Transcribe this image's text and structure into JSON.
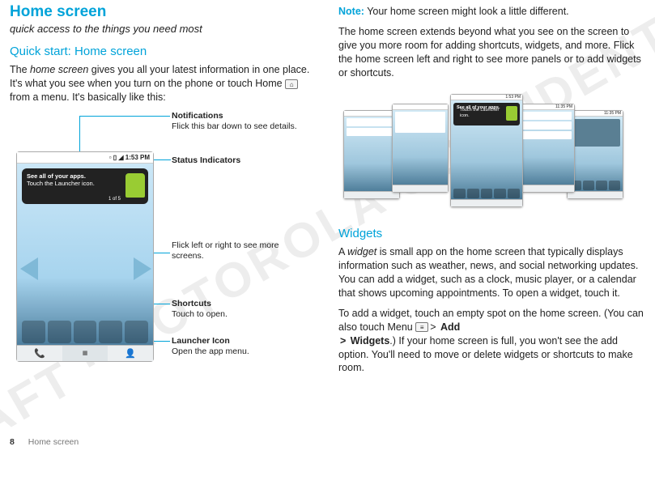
{
  "title": "Home screen",
  "subtitle": "quick access to the things you need most",
  "section_quick": "Quick start: Home screen",
  "intro_1": "The ",
  "intro_home_screen": "home screen",
  "intro_2": " gives you all your latest information in one place. It's what you see when you turn on the phone or touch Home ",
  "intro_3": " from a menu. It's basically like this:",
  "statusbar_time": "1:53 PM",
  "signal_icons": "▫ ▯ ◢",
  "tip_line1": "See all of your apps.",
  "tip_line2": "Touch the Launcher icon.",
  "tip_page": "1 of 5",
  "callouts": {
    "notif_head": "Notifications",
    "notif_body": "Flick this bar down to see details.",
    "status_head": "Status Indicators",
    "flick_body": "Flick left or right to see more screens.",
    "shortcuts_head": "Shortcuts",
    "shortcuts_body": "Touch to open.",
    "launcher_head": "Launcher Icon",
    "launcher_body": "Open the app menu."
  },
  "nav": {
    "left": "📞",
    "mid": "▦",
    "right": "👤"
  },
  "note_label": "Note:",
  "note_body": " Your home screen might look a little different.",
  "para2": "The home screen extends beyond what you see on the screen to give you more room for adding shortcuts, widgets, and more. Flick the home screen left and right to see more panels or to add widgets or shortcuts.",
  "panel_times": {
    "a": "1:53 PM",
    "b": "11:35 PM"
  },
  "section_widgets": "Widgets",
  "w_1": "A ",
  "w_widget": "widget",
  "w_2": " is small app on the home screen that typically displays information such as weather, news, and social networking updates. You can add a widget, such as a clock, music player, or a calendar that shows upcoming appointments. To open a widget, touch it.",
  "w_para2a": "To add a widget, touch an empty spot on the home screen. (You can also touch Menu ",
  "w_para2_gt": ">",
  "w_para2_add": "Add",
  "w_para2b": " ",
  "w_para2_widgets": "Widgets",
  "w_para2c": ".) If your home screen is full, you won't see the add option. You'll need to move or delete widgets or shortcuts to make room.",
  "footer_page": "8",
  "footer_label": "Home screen"
}
